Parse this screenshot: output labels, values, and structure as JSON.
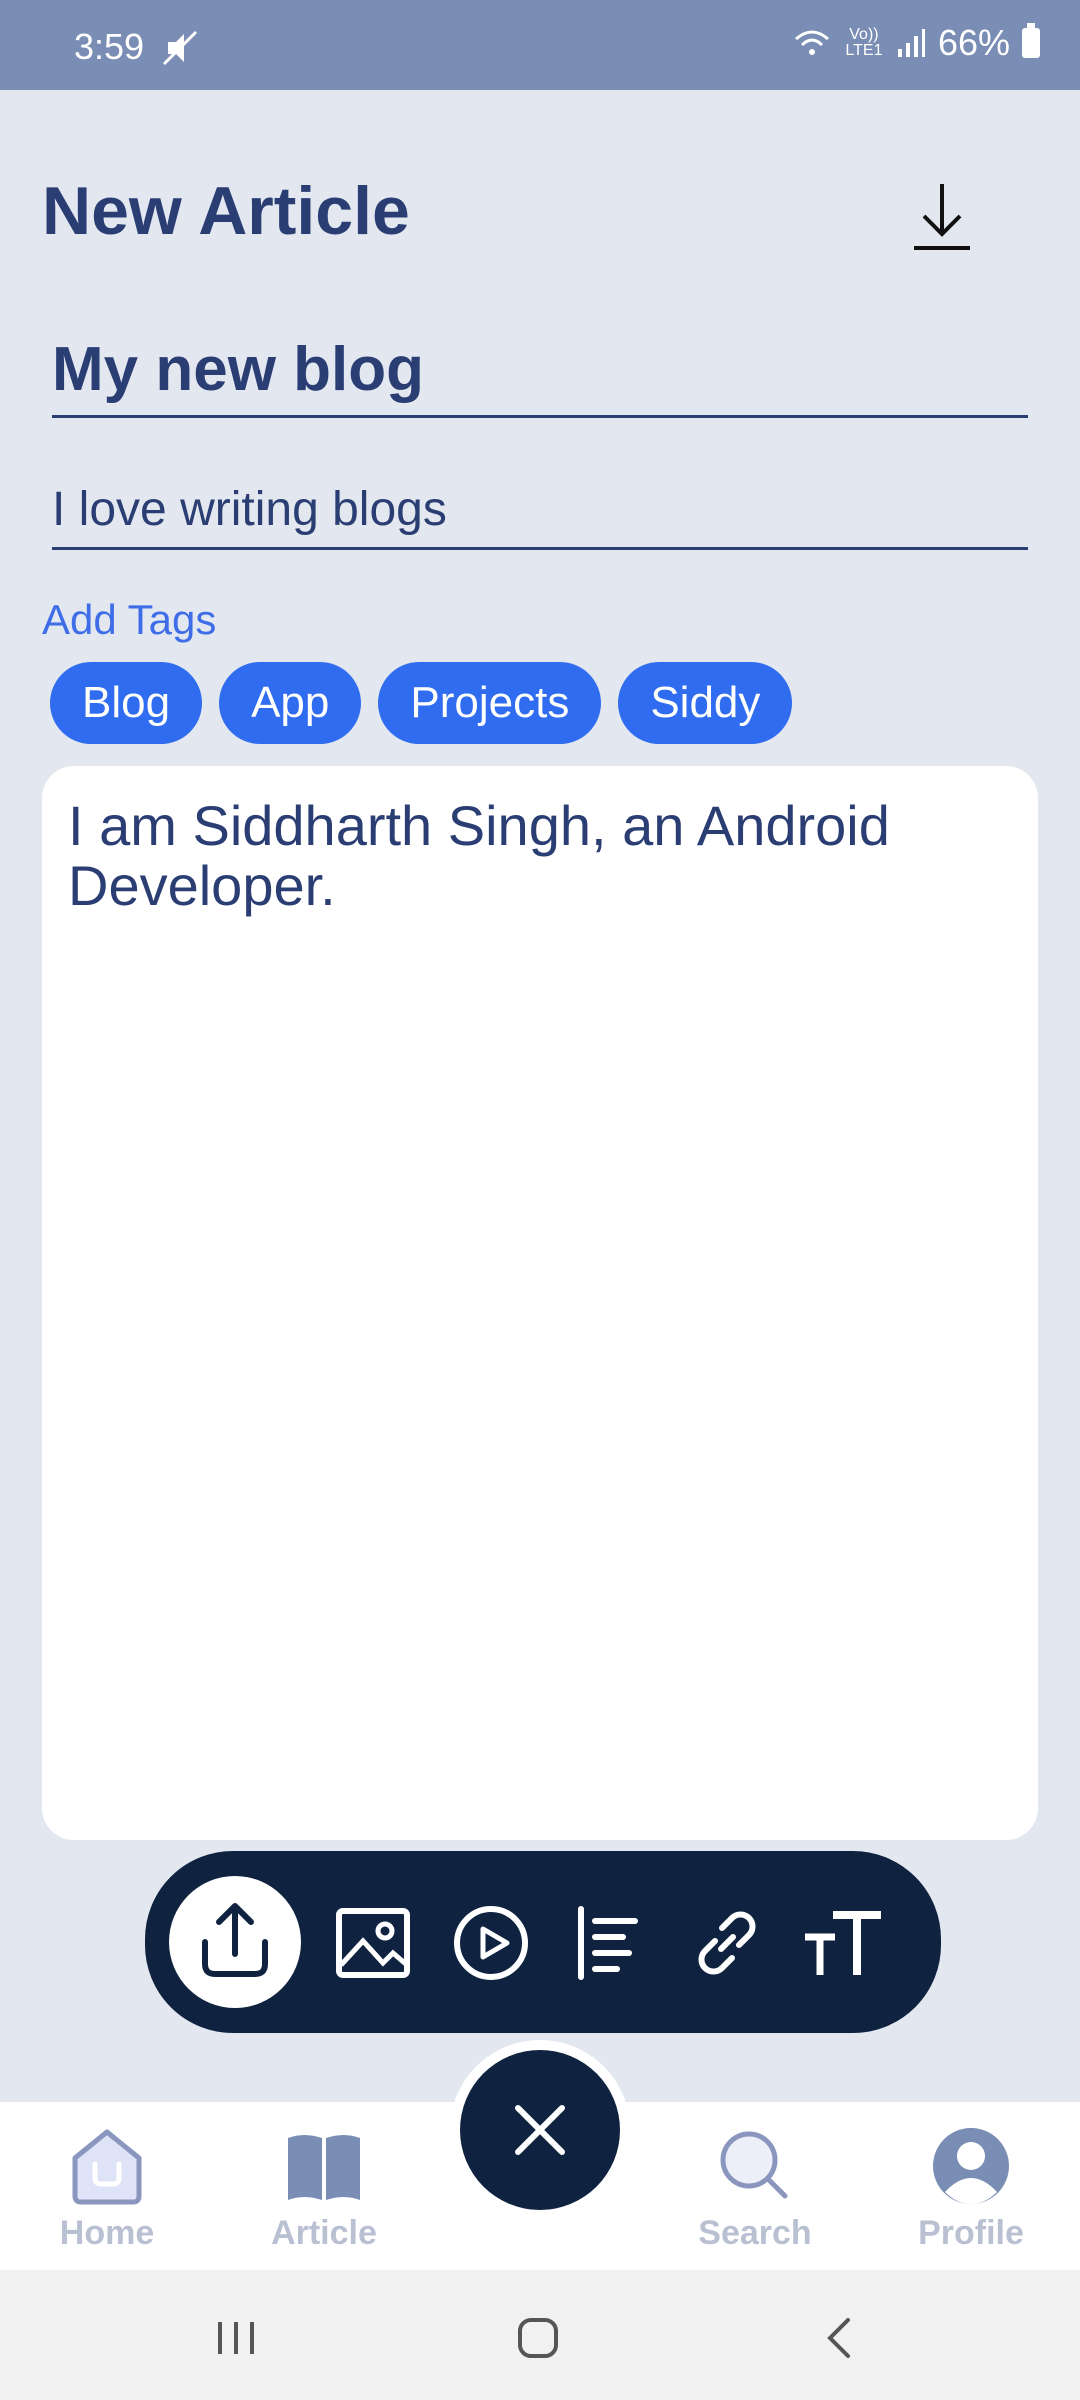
{
  "status_bar": {
    "time": "3:59",
    "network": "Vo)) LTE1",
    "battery": "66%"
  },
  "header": {
    "title": "New Article",
    "download_icon": "download-icon"
  },
  "article": {
    "title_value": "My new blog",
    "subtitle_value": "I love writing blogs",
    "add_tags_label": "Add Tags",
    "tags": [
      "Blog",
      "App",
      "Projects",
      "Siddy"
    ],
    "body_value": "I am Siddharth Singh, an Android Developer."
  },
  "toolbar": {
    "icons": [
      "upload-icon",
      "image-icon",
      "video-icon",
      "align-left-icon",
      "link-icon",
      "text-size-icon"
    ]
  },
  "bottom_nav": {
    "items": [
      {
        "label": "Home",
        "icon": "home-icon"
      },
      {
        "label": "Article",
        "icon": "book-icon"
      },
      {
        "label": "Search",
        "icon": "search-icon"
      },
      {
        "label": "Profile",
        "icon": "profile-icon"
      }
    ],
    "fab_icon": "close-icon"
  },
  "colors": {
    "background": "#e3e8f0",
    "primary": "#2b3e74",
    "accent": "#2f6cf0",
    "dark": "#0f2340",
    "status_bar": "#7a8db4"
  }
}
